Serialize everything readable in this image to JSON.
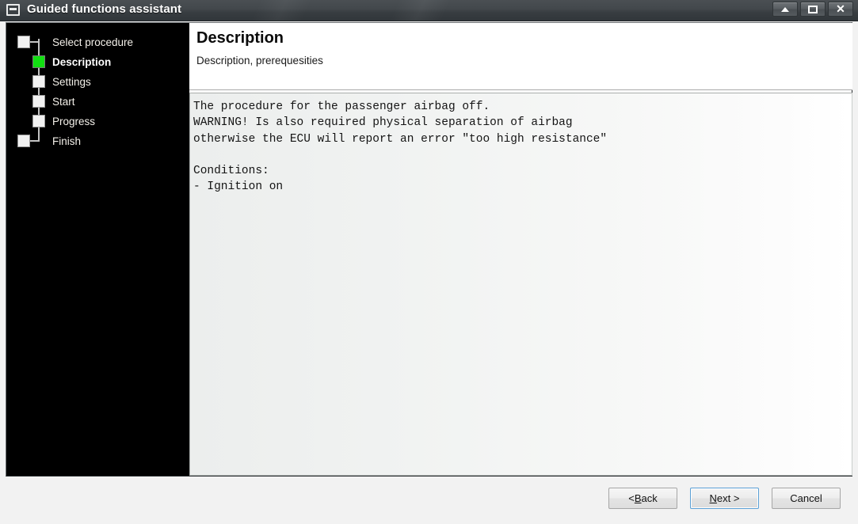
{
  "window": {
    "title": "Guided functions assistant",
    "icon": "window-restore-icon",
    "controls": [
      {
        "name": "shade-button",
        "glyph": "up-arrow"
      },
      {
        "name": "restore-button",
        "glyph": "restore-square"
      },
      {
        "name": "close-button",
        "glyph": "X"
      }
    ]
  },
  "sidebar": {
    "steps": [
      {
        "label": "Select procedure",
        "state": "pending",
        "node": "end"
      },
      {
        "label": "Description",
        "state": "active",
        "node": "mid"
      },
      {
        "label": "Settings",
        "state": "pending",
        "node": "mid"
      },
      {
        "label": "Start",
        "state": "pending",
        "node": "mid"
      },
      {
        "label": "Progress",
        "state": "pending",
        "node": "mid"
      },
      {
        "label": "Finish",
        "state": "pending",
        "node": "end"
      }
    ],
    "active_color": "#12e012",
    "background": "#000000"
  },
  "header": {
    "title": "Description",
    "subtitle": "Description, prerequesities"
  },
  "content": {
    "body": "The procedure for the passenger airbag off.\nWARNING! Is also required physical separation of airbag\notherwise the ECU will report an error \"too high resistance\"\n\nConditions:\n- Ignition on"
  },
  "footer": {
    "buttons": [
      {
        "name": "back-button",
        "prefix": "< ",
        "mnemonic": "B",
        "suffix": "ack",
        "focused": false
      },
      {
        "name": "next-button",
        "prefix": "",
        "mnemonic": "N",
        "suffix": "ext >",
        "focused": true
      },
      {
        "name": "cancel-button",
        "prefix": "Cancel",
        "mnemonic": "",
        "suffix": "",
        "focused": false
      }
    ]
  }
}
